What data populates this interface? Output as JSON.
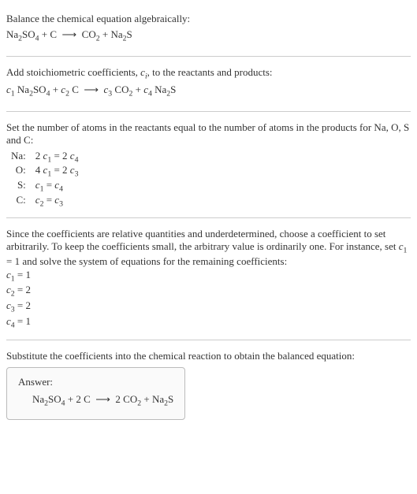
{
  "section1": {
    "title": "Balance the chemical equation algebraically:",
    "equation_html": "Na<span class='sub'>2</span>SO<span class='sub'>4</span> + C &nbsp;⟶&nbsp; CO<span class='sub'>2</span> + Na<span class='sub'>2</span>S"
  },
  "section2": {
    "text_html": "Add stoichiometric coefficients, <span class='ital'>c<span class='sub'>i</span></span>, to the reactants and products:",
    "equation_html": "<span class='ital'>c</span><span class='sub'>1</span> Na<span class='sub'>2</span>SO<span class='sub'>4</span> + <span class='ital'>c</span><span class='sub'>2</span> C &nbsp;⟶&nbsp; <span class='ital'>c</span><span class='sub'>3</span> CO<span class='sub'>2</span> + <span class='ital'>c</span><span class='sub'>4</span> Na<span class='sub'>2</span>S"
  },
  "section3": {
    "text": "Set the number of atoms in the reactants equal to the number of atoms in the products for Na, O, S and C:",
    "rows": [
      {
        "el": "Na:",
        "eq_html": "2 <span class='ital'>c</span><span class='sub'>1</span> = 2 <span class='ital'>c</span><span class='sub'>4</span>"
      },
      {
        "el": "O:",
        "eq_html": "4 <span class='ital'>c</span><span class='sub'>1</span> = 2 <span class='ital'>c</span><span class='sub'>3</span>"
      },
      {
        "el": "S:",
        "eq_html": "<span class='ital'>c</span><span class='sub'>1</span> = <span class='ital'>c</span><span class='sub'>4</span>"
      },
      {
        "el": "C:",
        "eq_html": "<span class='ital'>c</span><span class='sub'>2</span> = <span class='ital'>c</span><span class='sub'>3</span>"
      }
    ]
  },
  "section4": {
    "text_html": "Since the coefficients are relative quantities and underdetermined, choose a coefficient to set arbitrarily. To keep the coefficients small, the arbitrary value is ordinarily one. For instance, set <span class='ital'>c</span><span class='sub'>1</span> = 1 and solve the system of equations for the remaining coefficients:",
    "coeffs": [
      "<span class='ital'>c</span><span class='sub'>1</span> = 1",
      "<span class='ital'>c</span><span class='sub'>2</span> = 2",
      "<span class='ital'>c</span><span class='sub'>3</span> = 2",
      "<span class='ital'>c</span><span class='sub'>4</span> = 1"
    ]
  },
  "section5": {
    "text": "Substitute the coefficients into the chemical reaction to obtain the balanced equation:",
    "answer_label": "Answer:",
    "answer_html": "Na<span class='sub'>2</span>SO<span class='sub'>4</span> + 2 C &nbsp;⟶&nbsp; 2 CO<span class='sub'>2</span> + Na<span class='sub'>2</span>S"
  }
}
